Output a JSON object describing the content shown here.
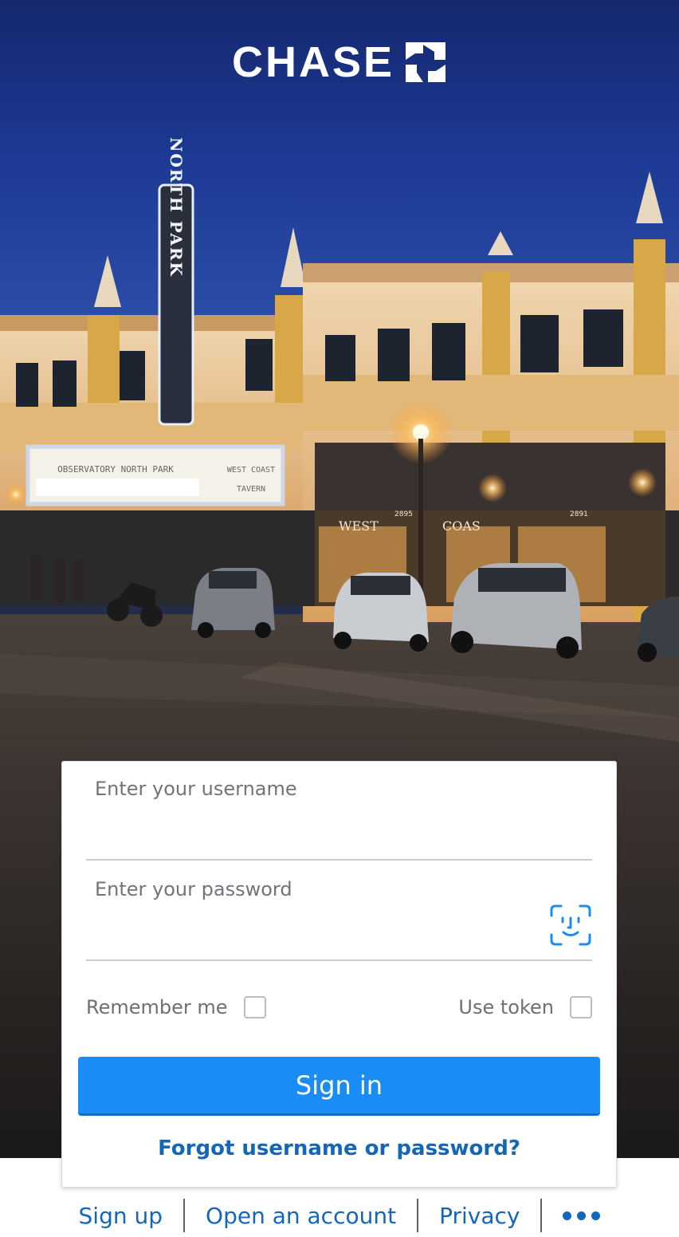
{
  "brand": {
    "name": "CHASE",
    "logo_icon": "chase-octagon-icon"
  },
  "background": {
    "scene": "street-photo",
    "signs": [
      "NORTH PARK",
      "OBSERVATORY NORTH PARK",
      "WEST",
      "COAST",
      "2895",
      "2891",
      "TAVERN"
    ]
  },
  "login": {
    "username_label": "Enter your username",
    "password_label": "Enter your password",
    "faceid_icon": "face-id-icon",
    "remember_label": "Remember me",
    "token_label": "Use token",
    "signin_label": "Sign in",
    "forgot_label": "Forgot username or password?"
  },
  "footer": {
    "links": [
      "Sign up",
      "Open an account",
      "Privacy"
    ],
    "more_icon": "more-dots-icon"
  },
  "colors": {
    "primary": "#1a8cf5",
    "link": "#1466b8",
    "border": "#c9cdd1"
  }
}
